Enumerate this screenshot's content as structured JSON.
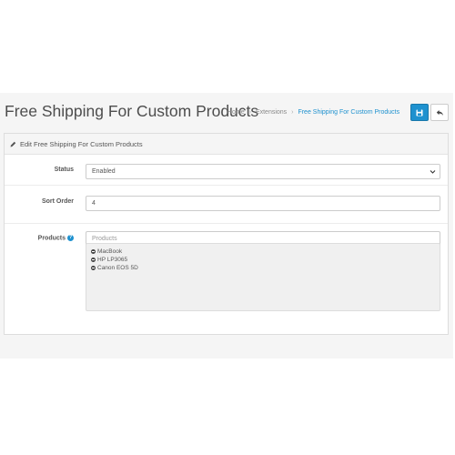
{
  "header": {
    "title": "Free Shipping For Custom Products",
    "breadcrumb": [
      "Home",
      "Extensions",
      "Free Shipping For Custom Products"
    ],
    "save_icon": "save-icon",
    "back_icon": "reply-icon"
  },
  "panel": {
    "heading": "Edit Free Shipping For Custom Products",
    "heading_icon": "pencil-icon"
  },
  "form": {
    "status": {
      "label": "Status",
      "value": "Enabled"
    },
    "sort_order": {
      "label": "Sort Order",
      "value": "4"
    },
    "products": {
      "label": "Products",
      "placeholder": "Products",
      "help_icon": "question-circle-icon",
      "items": [
        "MacBook",
        "HP LP3065",
        "Canon EOS 5D"
      ]
    }
  },
  "colors": {
    "primary": "#1e91cf",
    "page_background": "#f5f5f5"
  }
}
